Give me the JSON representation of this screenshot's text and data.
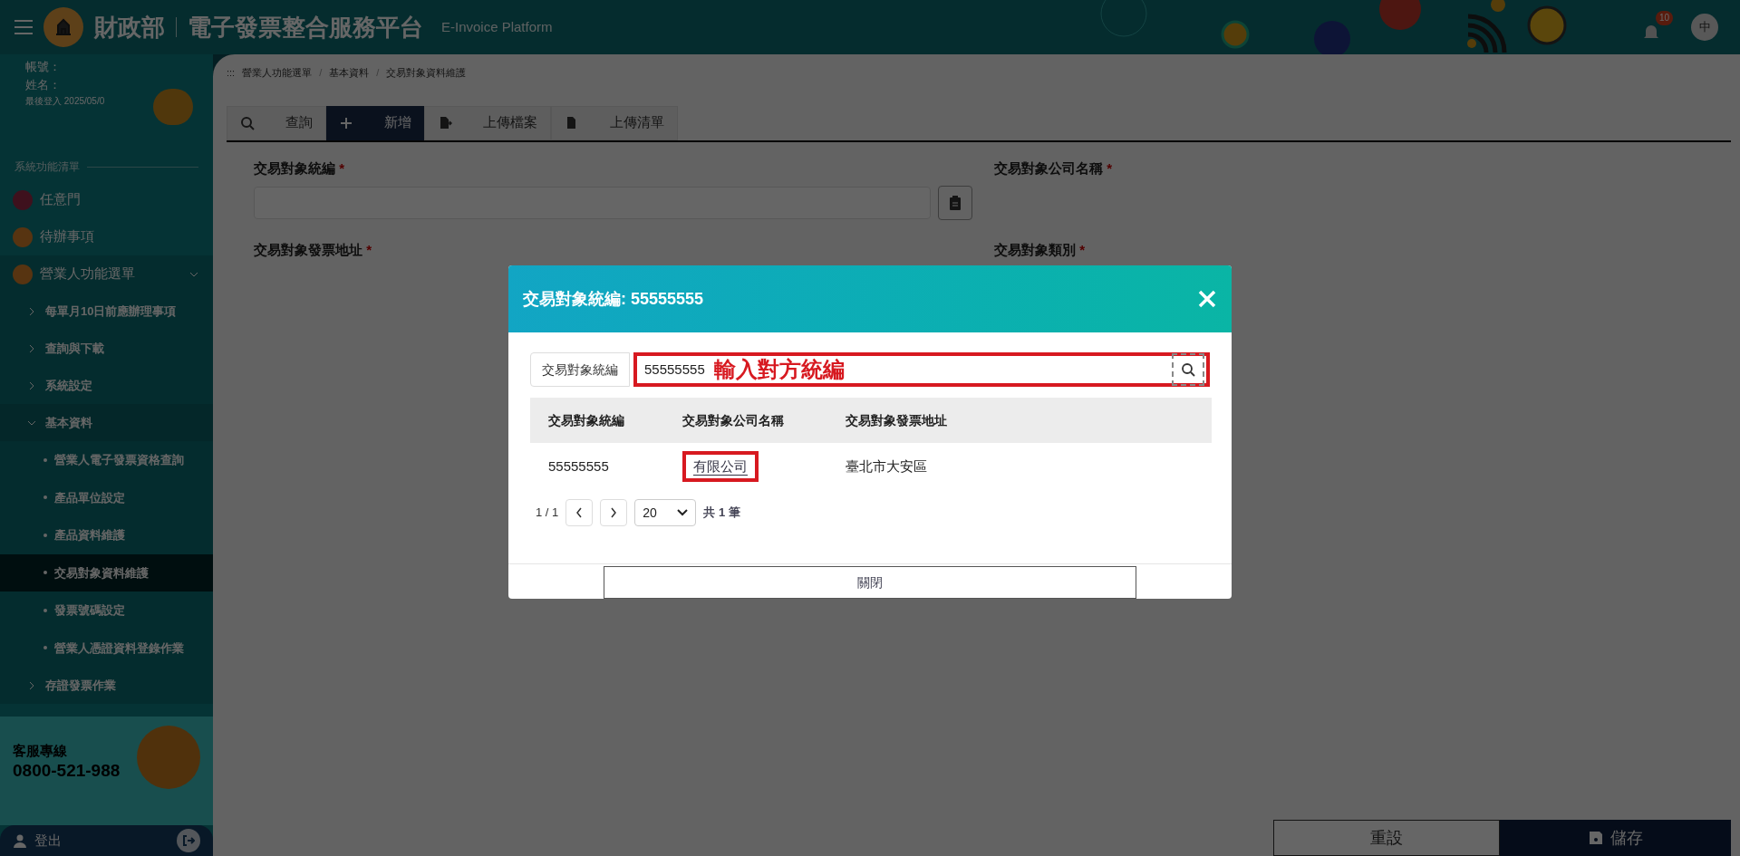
{
  "header": {
    "org": "財政部",
    "title": "電子發票整合服務平台",
    "subtitle": "E-Invoice Platform",
    "notification_count": "10",
    "language": "中"
  },
  "user": {
    "account_label": "帳號：",
    "name_label": "姓名：",
    "last_login": "最後登入 2025/05/0"
  },
  "sidebar": {
    "heading": "系統功能清單",
    "items": [
      {
        "label": "任意門",
        "selected": false
      },
      {
        "label": "待辦事項",
        "selected": false
      },
      {
        "label": "營業人功能選單",
        "selected": false,
        "expanded": true,
        "children": [
          {
            "label": "每單月10日前應辦理事項",
            "selected": false,
            "expanded": false
          },
          {
            "label": "查詢與下載",
            "selected": false,
            "expanded": false
          },
          {
            "label": "系統設定",
            "selected": false,
            "expanded": false
          },
          {
            "label": "基本資料",
            "selected": false,
            "expanded": true,
            "children": [
              {
                "label": "營業人電子發票資格查詢",
                "selected": false
              },
              {
                "label": "產品單位設定",
                "selected": false
              },
              {
                "label": "產品資料維護",
                "selected": false
              },
              {
                "label": "交易對象資料維護",
                "selected": true
              },
              {
                "label": "發票號碼設定",
                "selected": false
              },
              {
                "label": "營業人憑證資料登錄作業",
                "selected": false
              }
            ]
          },
          {
            "label": "存證發票作業",
            "selected": false,
            "expanded": false
          }
        ]
      }
    ]
  },
  "support": {
    "label": "客服專線",
    "phone": "0800-521-988"
  },
  "logout": "登出",
  "breadcrumb": {
    "prefix": ":::",
    "separator": "/",
    "items": [
      "營業人功能選單",
      "基本資料",
      "交易對象資料維護"
    ]
  },
  "tabs": [
    {
      "label": "查詢",
      "selected": false
    },
    {
      "label": "新增",
      "selected": true
    },
    {
      "label": "上傳檔案",
      "selected": false
    },
    {
      "label": "上傳清單",
      "selected": false
    }
  ],
  "form": {
    "fields": [
      {
        "label": "交易對象統編",
        "required_mark": "*"
      },
      {
        "label": "交易對象公司名稱",
        "required_mark": "*"
      },
      {
        "label": "交易對象發票地址",
        "required_mark": "*"
      },
      {
        "label": "交易對象類別",
        "required_mark": "*"
      }
    ]
  },
  "actions": {
    "reset": "重設",
    "save": "儲存"
  },
  "modal": {
    "title": "交易對象統編: 55555555",
    "search": {
      "label": "交易對象統編",
      "value": "55555555",
      "annotation": "輸入對方統編",
      "highlighted": true
    },
    "table": {
      "columns": [
        "交易對象統編",
        "交易對象公司名稱",
        "交易對象發票地址"
      ],
      "rows": [
        {
          "id": "55555555",
          "company": "有限公司",
          "company_highlighted": true,
          "address": "臺北市大安區"
        }
      ]
    },
    "pagination": {
      "page": "1 / 1",
      "page_size": "20",
      "total": "共 1 筆"
    },
    "close": "關閉"
  }
}
